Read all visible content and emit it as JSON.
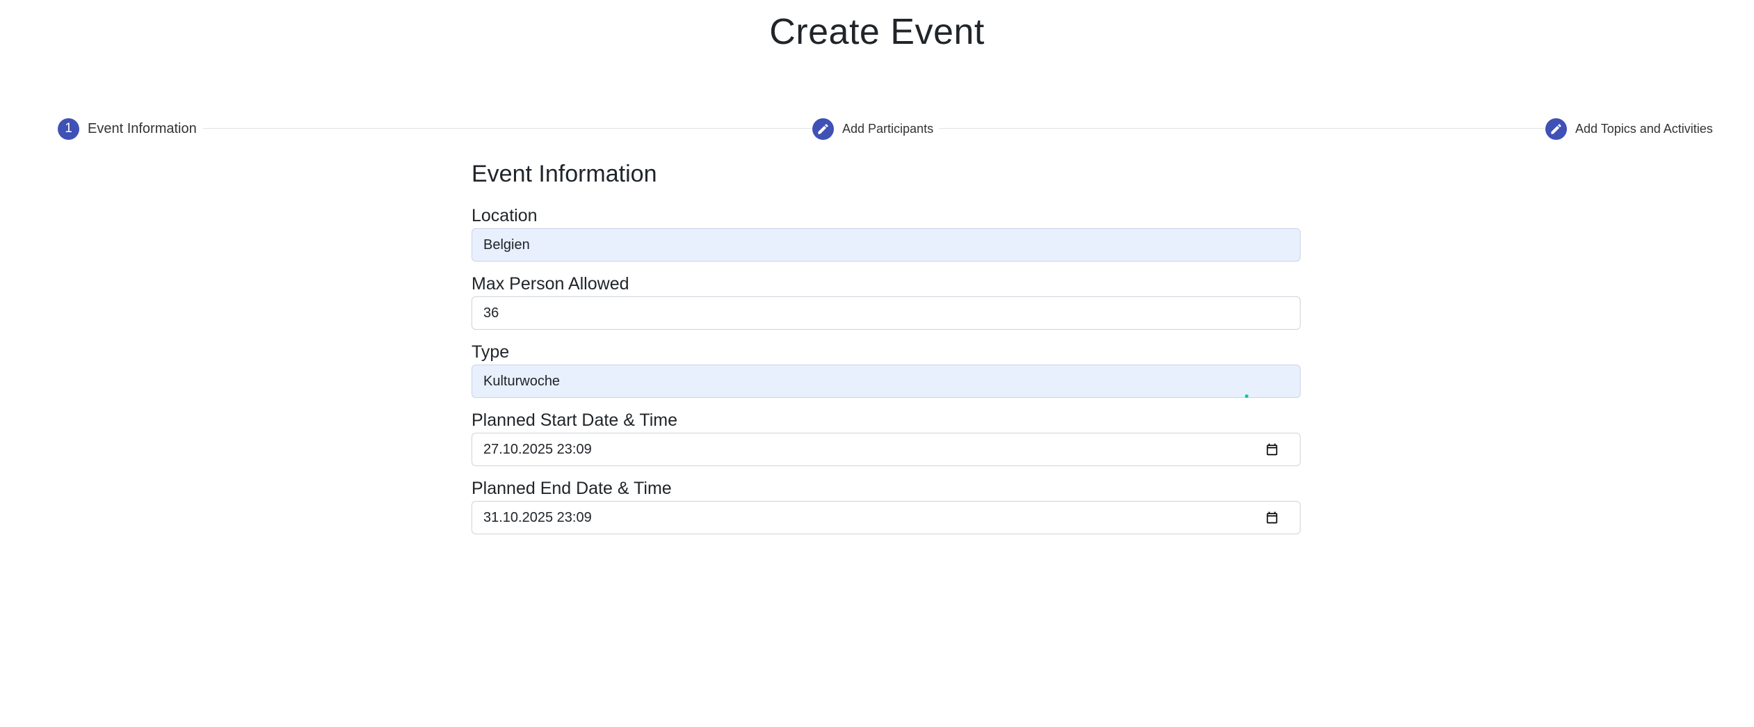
{
  "page": {
    "title": "Create Event"
  },
  "stepper": {
    "steps": [
      {
        "number": "1",
        "label": "Event Information",
        "icon": "step-number"
      },
      {
        "label": "Add Participants",
        "icon": "pencil-icon"
      },
      {
        "label": "Add Topics and Activities",
        "icon": "pencil-icon"
      }
    ],
    "colors": {
      "active": "#3f51b5"
    }
  },
  "form": {
    "section_title": "Event Information",
    "location": {
      "label": "Location",
      "value": "Belgien"
    },
    "max_persons": {
      "label": "Max Person Allowed",
      "value": "36"
    },
    "type": {
      "label": "Type",
      "value": "Kulturwoche"
    },
    "start": {
      "label": "Planned Start Date & Time",
      "value": "27.10.2025 23:09",
      "icon": "calendar-icon"
    },
    "end": {
      "label": "Planned End Date & Time",
      "value": "31.10.2025 23:09",
      "icon": "calendar-icon"
    }
  }
}
